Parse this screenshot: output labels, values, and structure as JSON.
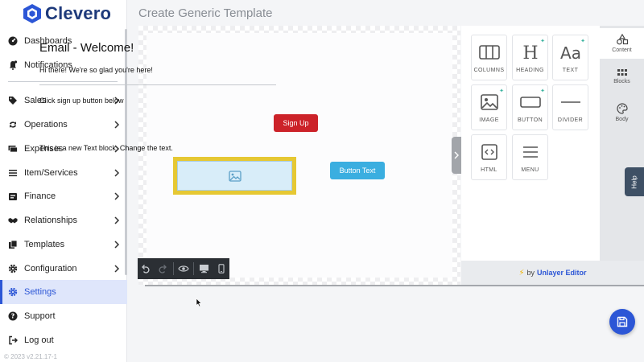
{
  "app": {
    "logo_text": "Clevero",
    "version": "© 2023  v2.21.17-1",
    "brand_color": "#2c56d6"
  },
  "sidebar": {
    "items": [
      {
        "label": "Dashboards",
        "icon": "dashboard-icon",
        "chevron": false
      },
      {
        "label": "Notifications",
        "icon": "bell-icon",
        "chevron": false
      },
      {
        "label": "Sales",
        "icon": "tag-icon",
        "chevron": true
      },
      {
        "label": "Operations",
        "icon": "repeat-icon",
        "chevron": true
      },
      {
        "label": "Expenses",
        "icon": "money-icon",
        "chevron": true
      },
      {
        "label": "Item/Services",
        "icon": "list-icon",
        "chevron": true
      },
      {
        "label": "Finance",
        "icon": "bank-icon",
        "chevron": true
      },
      {
        "label": "Relationships",
        "icon": "handshake-icon",
        "chevron": true
      },
      {
        "label": "Templates",
        "icon": "copy-icon",
        "chevron": true
      },
      {
        "label": "Configuration",
        "icon": "gear-icon",
        "chevron": true
      },
      {
        "label": "Settings",
        "icon": "gear-icon",
        "chevron": false,
        "active": true
      },
      {
        "label": "Support",
        "icon": "help-circle-icon",
        "chevron": false
      },
      {
        "label": "Log out",
        "icon": "logout-icon",
        "chevron": false
      }
    ]
  },
  "header": {
    "title": "Create Generic Template"
  },
  "email": {
    "heading": "Email - Welcome!",
    "greeting": "Hi there! We're so glad you're here!",
    "cta_text": "Click sign up button below",
    "signup_button": "Sign Up",
    "new_text_block": "This is a new Text block. Change the text.",
    "secondary_button": "Button Text",
    "selected_block_color": "#e6c833",
    "signup_color": "#cc2229",
    "secondary_color": "#3aaee0"
  },
  "tools": {
    "columns": "COLUMNS",
    "heading": "HEADING",
    "text": "TEXT",
    "image": "IMAGE",
    "button": "BUTTON",
    "divider": "DIVIDER",
    "html": "HTML",
    "menu": "MENU"
  },
  "tabs": {
    "content": "Content",
    "blocks": "Blocks",
    "body": "Body"
  },
  "footer": {
    "by": "by",
    "brand": "Unlayer Editor"
  },
  "help": {
    "label": "Help"
  }
}
